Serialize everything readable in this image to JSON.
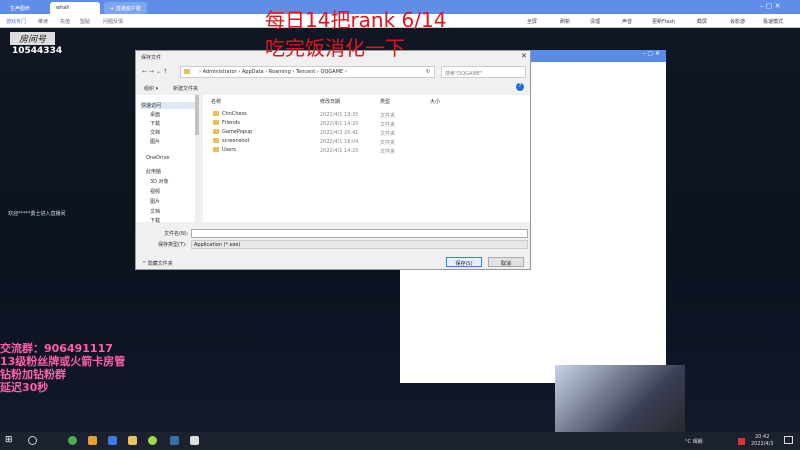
{
  "browser": {
    "tabs": [
      "生声图命",
      "whah",
      "+ 直播客户端"
    ],
    "nav": [
      "游戏专门",
      "推读",
      "充值",
      "盟贴",
      "问题反馈"
    ],
    "tools": [
      "全屏",
      "刷新",
      "清理",
      "声音",
      "更新Flash",
      "截屏",
      "会影游",
      "极速模式"
    ]
  },
  "stream": {
    "overlay_line1": "每日14把rank 6/14",
    "overlay_line2": "吃完饭消化一下",
    "room_label": "房间号",
    "room_number": "10544334",
    "welcome": "欢迎*****勇士进入直播间",
    "info": [
      "交流群：906491117",
      "13级粉丝牌或火箭卡房管",
      "钻粉加钻粉群",
      "延迟30秒"
    ]
  },
  "dialog": {
    "title": "保存文件",
    "path": [
      "Administrator",
      "AppData",
      "Roaming",
      "Tencent",
      "QQGAME"
    ],
    "search_placeholder": "搜索\"QQGAME\"",
    "organize": "组织 ▾",
    "new_folder": "新建文件夹",
    "nav": [
      "快速访问",
      "桌面",
      "下载",
      "文档",
      "图片",
      "OneDrive",
      "此电脑",
      "3D 对象",
      "视频",
      "图片",
      "文档",
      "下载"
    ],
    "columns": [
      "名称",
      "修改日期",
      "类型",
      "大小"
    ],
    "files": [
      {
        "name": "ChnChess",
        "date": "2022/4/1 19:35",
        "type": "文件夹"
      },
      {
        "name": "Friends",
        "date": "2022/4/1 14:20",
        "type": "文件夹"
      },
      {
        "name": "GamePopup",
        "date": "2022/4/3 20:41",
        "type": "文件夹"
      },
      {
        "name": "screenshot",
        "date": "2022/4/1 16:04",
        "type": "文件夹"
      },
      {
        "name": "Users",
        "date": "2022/4/1 14:20",
        "type": "文件夹"
      }
    ],
    "filename_label": "文件名(N):",
    "filename_value": "",
    "filetype_label": "保存类型(T):",
    "filetype_value": "Application (*.exe)",
    "hide_folders": "^ 隐藏文件夹",
    "save": "保存(S)",
    "cancel": "取消"
  },
  "taskbar": {
    "weather": "°C 晴朗",
    "time": "20:42",
    "date": "2022/4/3"
  }
}
